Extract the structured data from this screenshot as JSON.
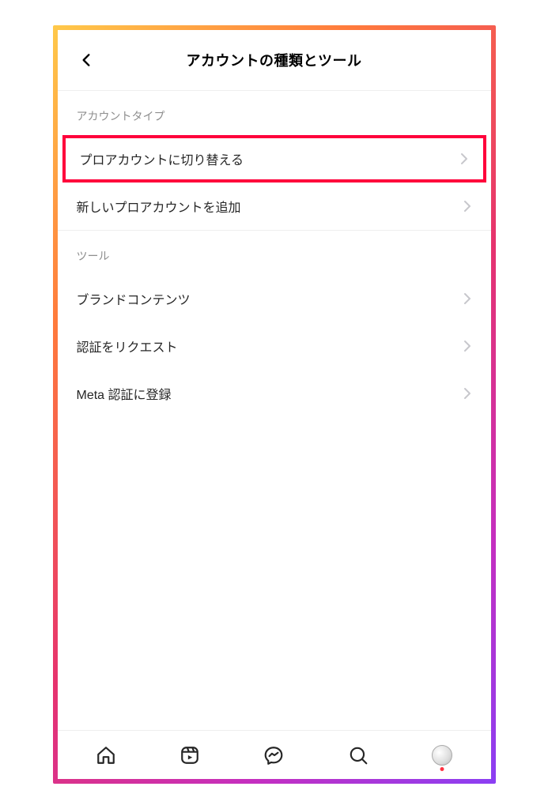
{
  "header": {
    "title": "アカウントの種類とツール"
  },
  "sections": {
    "account_type": {
      "label": "アカウントタイプ",
      "items": [
        {
          "label": "プロアカウントに切り替える"
        },
        {
          "label": "新しいプロアカウントを追加"
        }
      ]
    },
    "tools": {
      "label": "ツール",
      "items": [
        {
          "label": "ブランドコンテンツ"
        },
        {
          "label": "認証をリクエスト"
        },
        {
          "label": "Meta 認証に登録"
        }
      ]
    }
  }
}
